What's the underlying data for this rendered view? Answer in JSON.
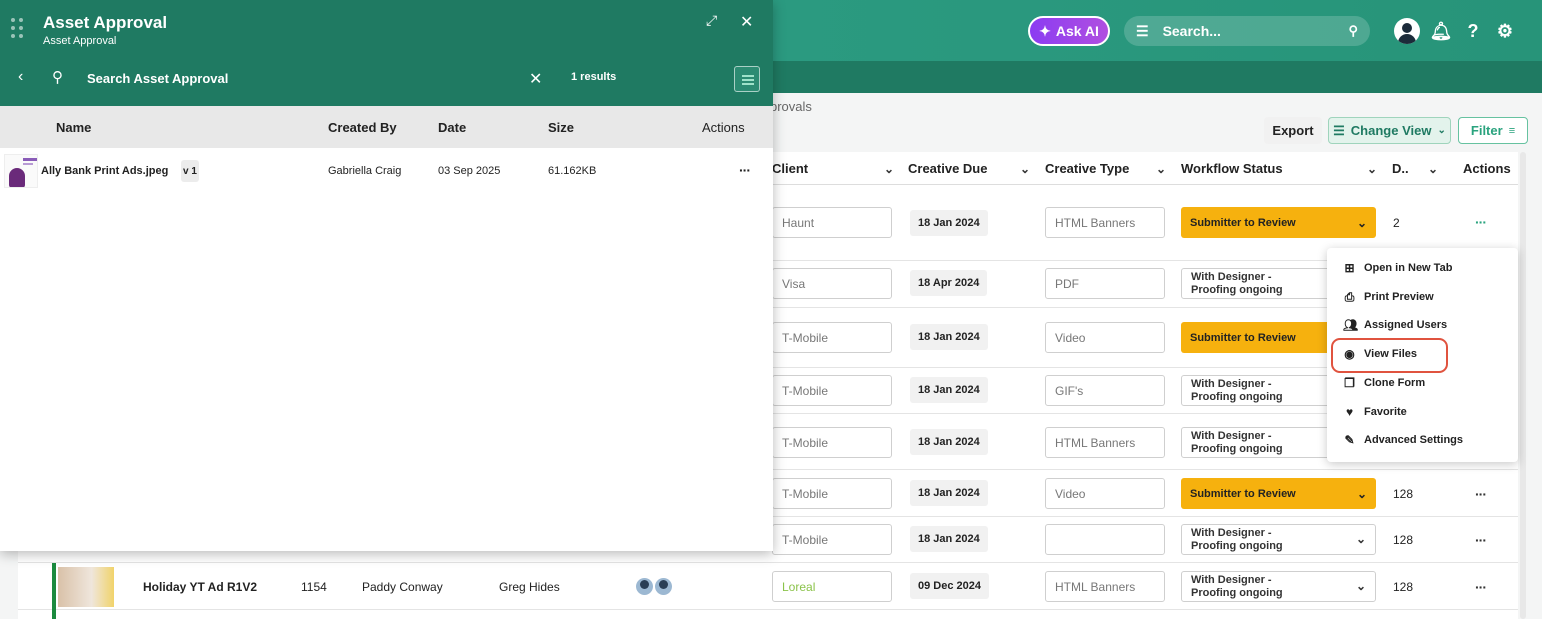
{
  "topbar": {
    "ask_ai_label": "Ask AI",
    "search_label": "Search...",
    "help_glyph": "?"
  },
  "breadcrumb_fragment": "provals",
  "toolbar": {
    "export_label": "Export",
    "change_view_label": "Change View",
    "filter_label": "Filter"
  },
  "grid": {
    "columns": [
      "Client",
      "Creative Due",
      "Creative Type",
      "Workflow Status",
      "D..",
      "Actions"
    ],
    "rows": [
      {
        "client": "Haunt",
        "due": "18 Jan 2024",
        "type": "HTML Banners",
        "status": "Submitter to Review",
        "status_style": "yellow",
        "num": "2"
      },
      {
        "client": "Visa",
        "due": "18 Apr 2024",
        "type": "PDF",
        "status_line1": "With Designer -",
        "status_line2": "Proofing ongoing",
        "status_style": "plain"
      },
      {
        "client": "T-Mobile",
        "due": "18 Jan 2024",
        "type": "Video",
        "status": "Submitter to Review",
        "status_style": "yellow"
      },
      {
        "client": "T-Mobile",
        "due": "18 Jan 2024",
        "type": "GIF's",
        "status_line1": "With Designer -",
        "status_line2": "Proofing ongoing",
        "status_style": "plain"
      },
      {
        "client": "T-Mobile",
        "due": "18 Jan 2024",
        "type": "HTML Banners",
        "status_line1": "With Designer -",
        "status_line2": "Proofing ongoing",
        "status_style": "plain"
      },
      {
        "client": "T-Mobile",
        "due": "18 Jan 2024",
        "type": "Video",
        "status": "Submitter to Review",
        "status_style": "yellow",
        "num": "128"
      },
      {
        "client": "T-Mobile",
        "due": "18 Jan 2024",
        "type": "",
        "status_line1": "With Designer -",
        "status_line2": "Proofing ongoing",
        "status_style": "plain",
        "num": "128"
      },
      {
        "client": "Loreal",
        "due": "09 Dec 2024",
        "type": "HTML Banners",
        "status_line1": "With Designer -",
        "status_line2": "Proofing ongoing",
        "status_style": "plain",
        "num": "128",
        "name": "Holiday YT Ad R1V2",
        "id": "1154",
        "owner": "Paddy Conway",
        "assignee": "Greg Hides"
      }
    ]
  },
  "context_menu": {
    "items": [
      {
        "label": "Open in New Tab",
        "icon": "plus-square-icon"
      },
      {
        "label": "Print Preview",
        "icon": "printer-icon"
      },
      {
        "label": "Assigned Users",
        "icon": "users-icon"
      },
      {
        "label": "View Files",
        "icon": "eye-icon"
      },
      {
        "label": "Clone Form",
        "icon": "copy-icon"
      },
      {
        "label": "Favorite",
        "icon": "heart-icon"
      },
      {
        "label": "Advanced Settings",
        "icon": "pencil-icon"
      }
    ],
    "highlighted": "View Files"
  },
  "panel": {
    "title": "Asset Approval",
    "subtitle": "Asset Approval",
    "search_placeholder": "Search Asset Approval",
    "results": "1 results",
    "columns": {
      "name": "Name",
      "created_by": "Created By",
      "date": "Date",
      "size": "Size",
      "actions": "Actions"
    },
    "files": [
      {
        "name": "Ally Bank Print Ads.jpeg",
        "version": "v 1",
        "created_by": "Gabriella Craig",
        "date": "03 Sep 2025",
        "size": "61.162KB"
      }
    ]
  },
  "colors": {
    "header_green": "#1f7a62",
    "accent_yellow": "#f6b10e",
    "ask_ai_purple": "#8b3cf2",
    "highlight_red": "#e0533f"
  }
}
